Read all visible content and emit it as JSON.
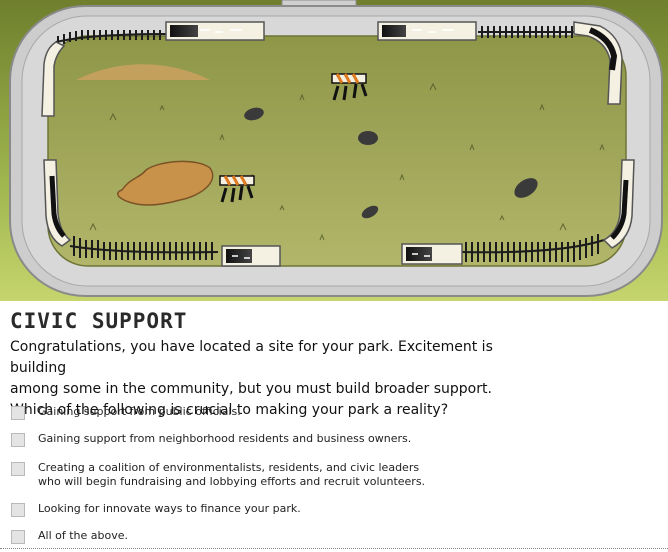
{
  "section_title": "Civic Support",
  "intro_lines": [
    "Congratulations, you have located a site for your park. Excitement is building",
    "among some in the community, but you must build broader support.",
    "Which of the following is crucial to making your park a reality?"
  ],
  "options": [
    {
      "label": "Gaining support from public officials.",
      "checked": false
    },
    {
      "label": "Gaining support from neighborhood residents and business owners.",
      "checked": false
    },
    {
      "label": "Creating a coalition of environmentalists, residents, and civic leaders\nwho will begin fundraising and lobbying efforts and recruit volunteers.",
      "checked": false
    },
    {
      "label": "Looking for innovate ways to finance your park.",
      "checked": false
    },
    {
      "label": "All of the above.",
      "checked": false
    }
  ],
  "colors": {
    "lawn": "#8fa043",
    "lot": "#a0a659",
    "sidewalk": "#c9c9c9",
    "dirt": "#c79a52",
    "barrier": "#f4f1e3",
    "fence": "#1c1c1c"
  }
}
